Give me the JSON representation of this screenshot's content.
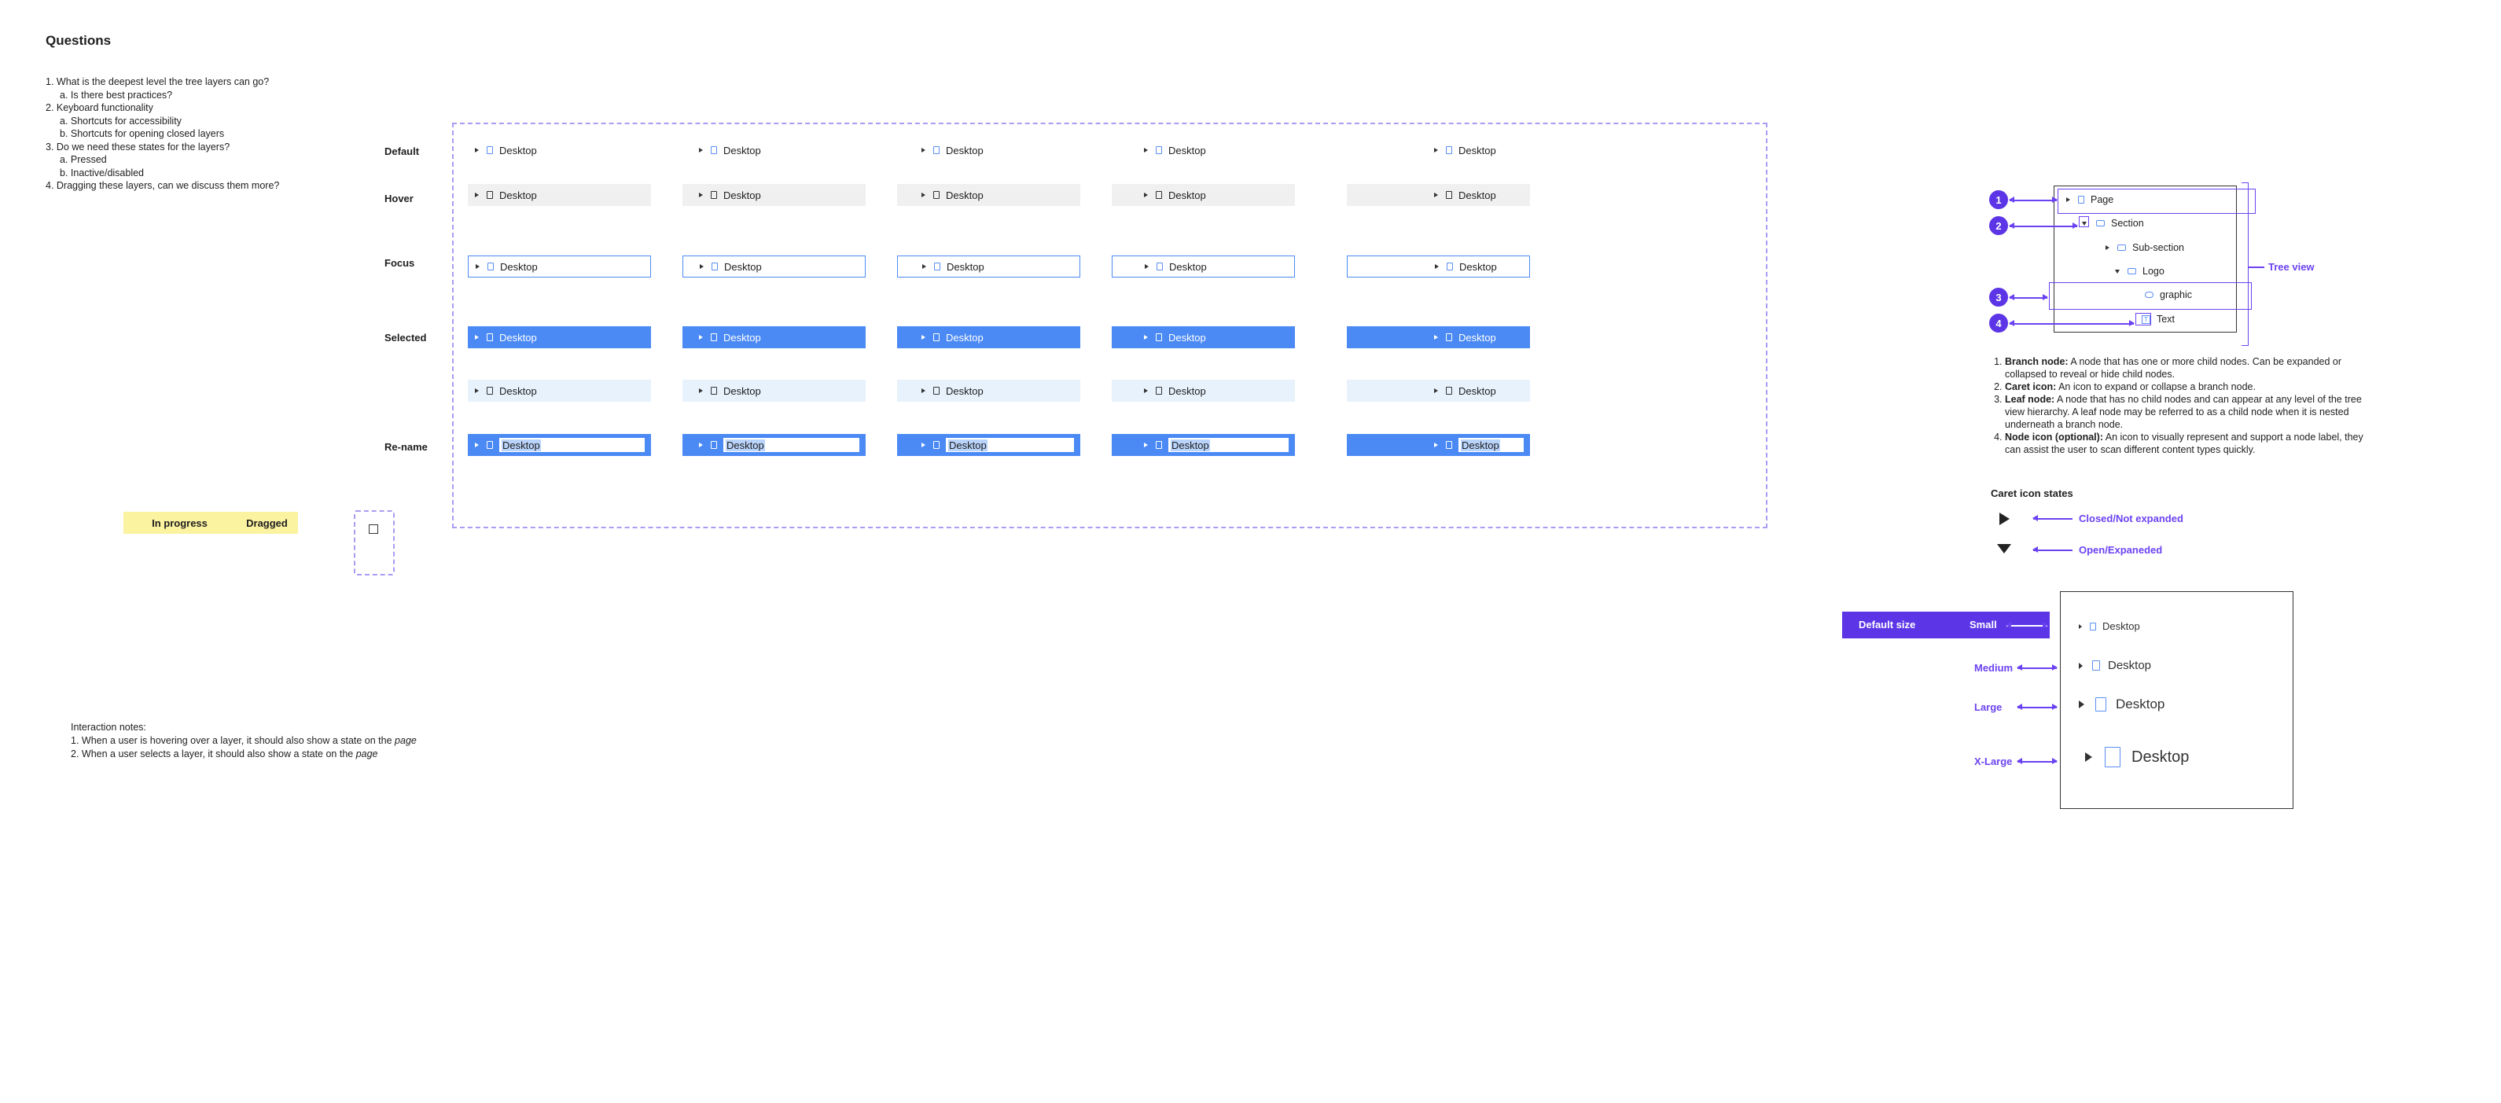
{
  "questions": {
    "title": "Questions",
    "items": [
      "1. What is the deepest level the tree layers can go?",
      "a. Is there best practices?",
      "2. Keyboard functionality",
      "a. Shortcuts for accessibility",
      "b. Shortcuts for opening closed layers",
      "3. Do we need these states for the layers?",
      "a. Pressed",
      "b. Inactive/disabled",
      "4. Dragging these layers, can we discuss them more?"
    ]
  },
  "states": {
    "default": "Default",
    "hover": "Hover",
    "focus": "Focus",
    "selected": "Selected",
    "rename": "Re-name",
    "item_label": "Desktop"
  },
  "badges": {
    "in_progress": "In progress",
    "dragged": "Dragged"
  },
  "notes": {
    "title": "Interaction notes:",
    "item1_prefix": "1.  When a user is hovering over a layer, it should also show a state on the ",
    "item1_em": "page",
    "item2_prefix": "2.  When a user selects a layer, it should also show a state on the ",
    "item2_em": "page"
  },
  "tree_view": {
    "label": "Tree view",
    "rows": [
      "Page",
      "Section",
      "Sub-section",
      "Logo",
      "graphic",
      "Text"
    ],
    "text_icon": "T",
    "numbers": [
      "1",
      "2",
      "3",
      "4"
    ]
  },
  "definitions": [
    {
      "term": "Branch node:",
      "desc": " A node that has one or more child nodes. Can be expanded or collapsed to reveal or hide child nodes."
    },
    {
      "term": "Caret icon:",
      "desc": " An icon to expand or collapse a branch node."
    },
    {
      "term": "Leaf node:",
      "desc": " A node that has no child nodes and can appear at any level of the tree view hierarchy. A leaf node may be referred to as a child node when it is nested underneath a branch node."
    },
    {
      "term": "Node icon (optional):",
      "desc": " An icon to visually represent and support a node label, they can assist the user to scan different content types quickly."
    }
  ],
  "caret_states": {
    "title": "Caret icon states",
    "closed": "Closed/Not expanded",
    "open": "Open/Expaneded"
  },
  "sizes": {
    "default_size": "Default size",
    "small": "Small",
    "medium": "Medium",
    "large": "Large",
    "xlarge": "X-Large",
    "item_label": "Desktop"
  },
  "colors": {
    "accent_blue": "#4b8af4",
    "accent_purple": "#5b35e6",
    "badge_yellow": "#fbf3a0",
    "hover_grey": "#f0f0f0",
    "light_blue": "#e8f2fd"
  }
}
